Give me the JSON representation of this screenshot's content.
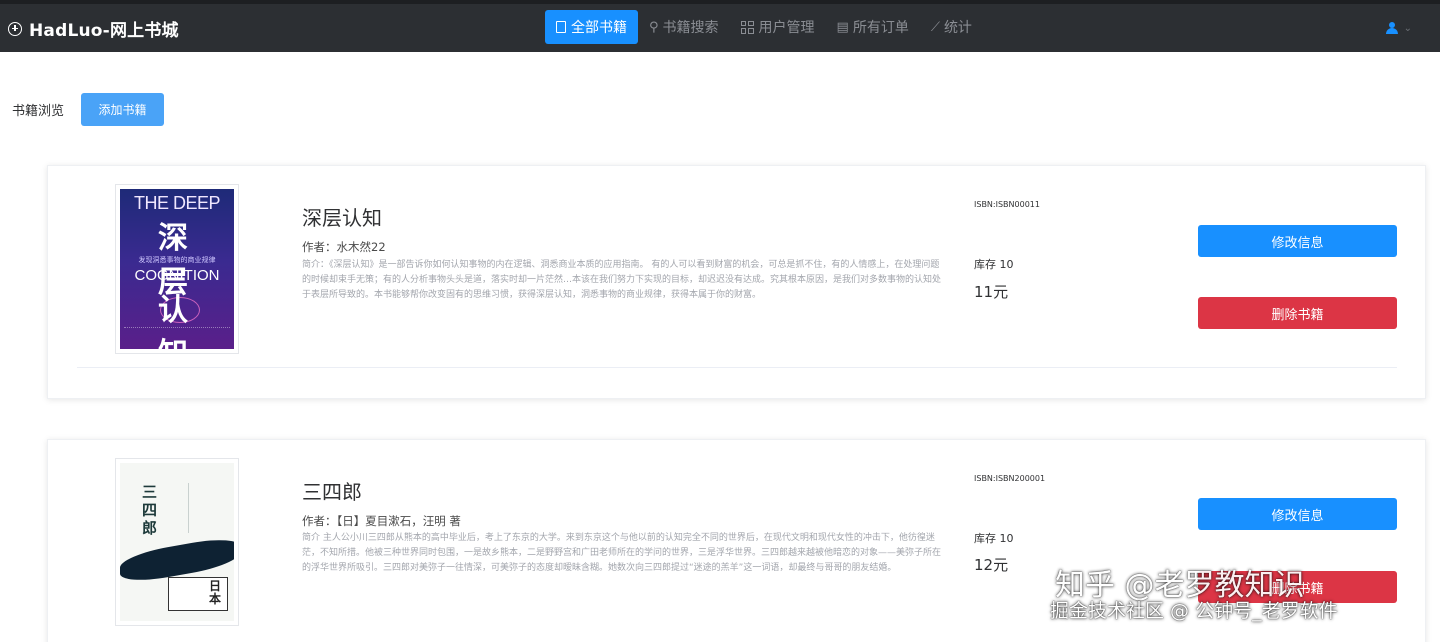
{
  "app": {
    "title": "HadLuo-网上书城"
  },
  "nav": [
    {
      "label": "全部书籍",
      "icon": "book-icon",
      "active": true
    },
    {
      "label": "书籍搜索",
      "icon": "search-icon",
      "active": false
    },
    {
      "label": "用户管理",
      "icon": "grid-icon",
      "active": false
    },
    {
      "label": "所有订单",
      "icon": "document-icon",
      "active": false
    },
    {
      "label": "统计",
      "icon": "chart-icon",
      "active": false
    }
  ],
  "user": {
    "icon": "user-icon",
    "caret": "⌄"
  },
  "toolbar": {
    "label": "书籍浏览",
    "add_label": "添加书籍"
  },
  "books": [
    {
      "title": "深层认知",
      "author": "作者：水木然22",
      "description": "简介：《深层认知》是一部告诉你如何认知事物的内在逻辑、洞悉商业本质的应用指南。 有的人可以看到财富的机会，可总是抓不住，有的人情感上，在处理问题的时候却束手无策；有的人分析事物头头是道，落实时却一片茫然…本该在我们努力下实现的目标，却迟迟没有达成。究其根本原因，是我们对多数事物的认知处于表层所导致的。本书能够帮你改变固有的思维习惯，获得深层认知，洞悉事物的商业规律，获得本属于你的财富。",
      "isbn": "ISBN:ISBN00011",
      "stock": "库存  10",
      "price": "11元",
      "cover": {
        "en_top": "THE DEEP",
        "cn_top": "深层",
        "subtitle": "发现洞悉事物的商业规律",
        "en_bottom": "COGNITION",
        "cn_bottom": "认知"
      },
      "edit_label": "修改信息",
      "delete_label": "删除书籍"
    },
    {
      "title": "三四郎",
      "author": "作者：【日】夏目漱石，汪明  著",
      "description": "简介 主人公小川三四郎从熊本的高中毕业后，考上了东京的大学。来到东京这个与他以前的认知完全不同的世界后，在现代文明和现代女性的冲击下，他彷徨迷茫，不知所措。他被三种世界同时包围，一是故乡熊本，二是野野宫和广田老师所在的学问的世界，三是浮华世界。三四郎越来越被他暗恋的对象——美弥子所在的浮华世界所吸引。三四郎对美弥子一往情深，可美弥子的态度却暧昧含糊。她数次向三四郎提过“迷途的羔羊”这一词语，却最终与哥哥的朋友结婚。",
      "isbn": "ISBN:ISBN200001",
      "stock": "库存  10",
      "price": "12元",
      "cover": {
        "cn_title": "三四郎",
        "badge": "日本"
      },
      "edit_label": "修改信息",
      "delete_label": "删除书籍"
    }
  ],
  "watermark": {
    "line1": "知乎 @老罗教知识",
    "line2": "掘金技术社区 @ 公钟号_老罗软件"
  },
  "colors": {
    "topbar": "#2c2f33",
    "primary": "#1890ff",
    "danger": "#dc3545",
    "add_button": "#4aa3f7"
  }
}
